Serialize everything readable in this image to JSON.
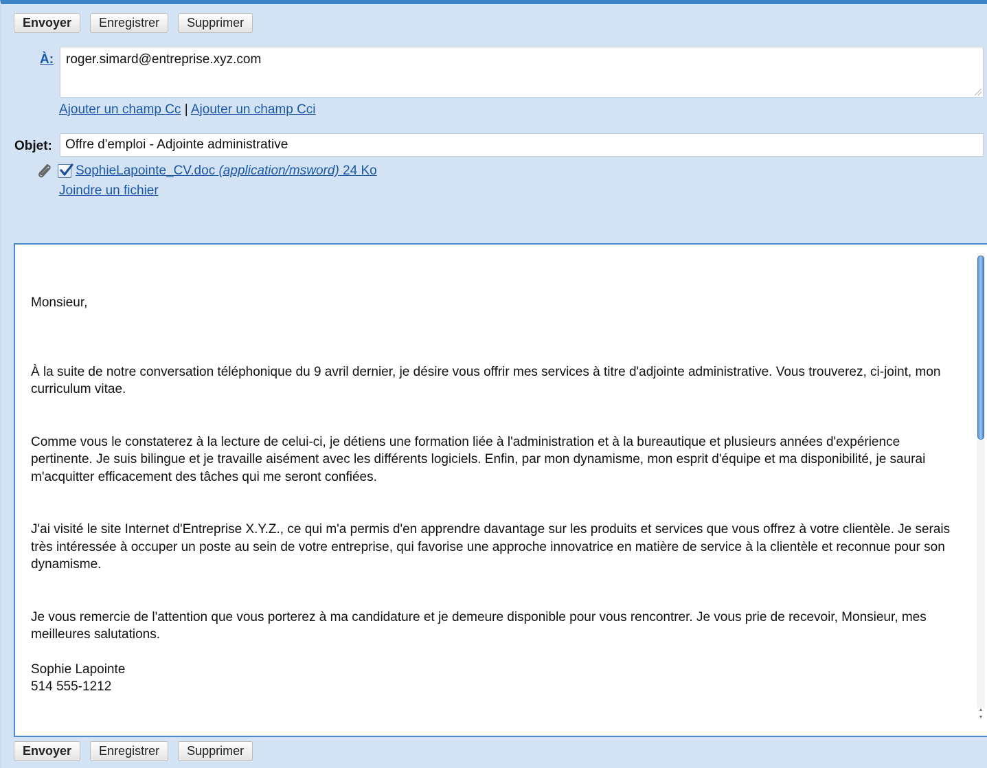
{
  "toolbar": {
    "send_label": "Envoyer",
    "save_label": "Enregistrer",
    "delete_label": "Supprimer"
  },
  "to": {
    "label": "À:",
    "value": "roger.simard@entreprise.xyz.com"
  },
  "cc": {
    "add_cc_label": "Ajouter un champ Cc",
    "separator": "|",
    "add_bcc_label": "Ajouter un champ Cci"
  },
  "subject": {
    "label": "Objet:",
    "value": "Offre d'emploi - Adjointe administrative"
  },
  "attachment": {
    "filename": "SophieLapointe_CV.doc",
    "mime": "(application/msword)",
    "size": "24 Ko",
    "checked": true,
    "attach_file_label": "Joindre un fichier"
  },
  "message": {
    "greeting": "Monsieur,",
    "paragraphs": [
      "À la suite de notre conversation téléphonique du 9 avril dernier, je désire vous offrir mes services à titre d'adjointe administrative. Vous trouverez, ci-joint, mon curriculum vitae.",
      "Comme vous le constaterez à la lecture de celui-ci, je détiens une formation liée à l'administration et à la bureautique et plusieurs années d'expérience pertinente. Je suis bilingue et je travaille aisément avec les différents logiciels. Enfin, par mon dynamisme, mon esprit d'équipe et ma disponibilité, je saurai m'acquitter efficacement des tâches qui me seront confiées.",
      "J'ai visité le site Internet d'Entreprise X.Y.Z., ce qui m'a permis d'en apprendre davantage sur les produits et services que vous offrez à votre clientèle. Je serais très intéressée à occuper un poste au sein de votre entreprise, qui favorise une approche innovatrice en matière de service à la clientèle et reconnue pour son dynamisme.",
      "Je vous remercie de l'attention que vous porterez à ma candidature et je demeure disponible pour vous rencontrer. Je vous prie de recevoir, Monsieur, mes meilleures salutations."
    ],
    "signature_name": "Sophie Lapointe",
    "signature_phone": "514 555-1212"
  },
  "colors": {
    "panel_bg": "#d3e3f4",
    "accent": "#3d83c8",
    "link": "#1a57a8"
  }
}
